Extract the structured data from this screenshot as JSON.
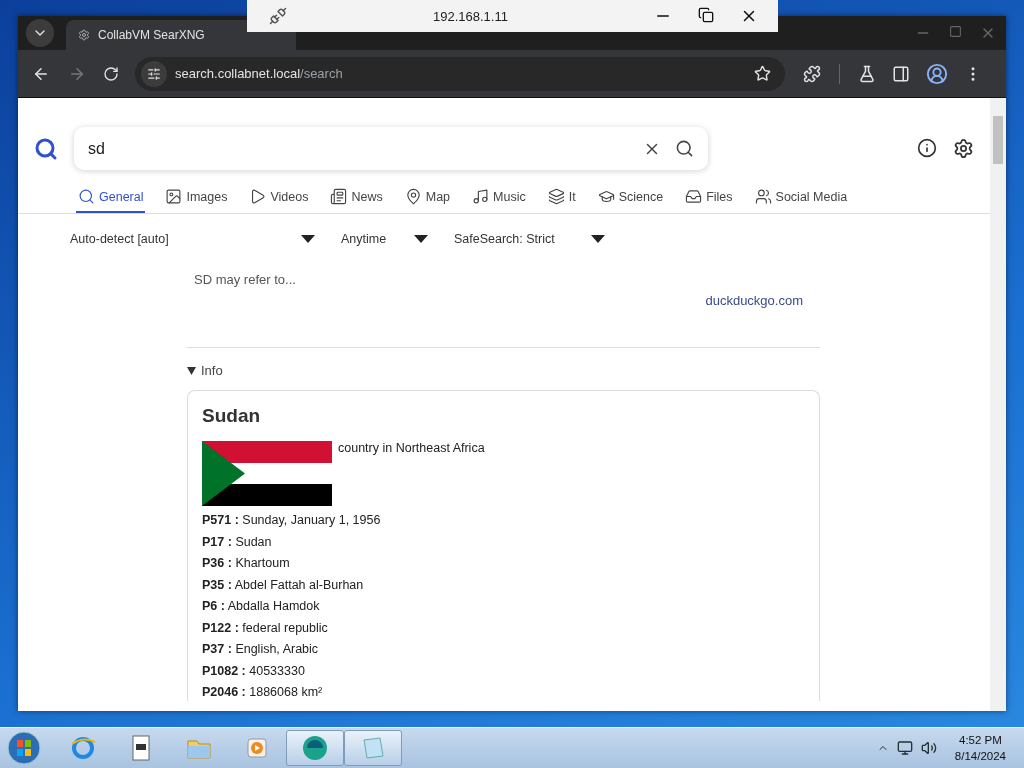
{
  "remote_bar": {
    "address": "192.168.1.11"
  },
  "browser": {
    "tab_title": "CollabVM SearXNG",
    "address": {
      "host": "search.collabnet.local",
      "path": "/search"
    }
  },
  "search": {
    "query": "sd"
  },
  "categories": [
    {
      "kind": "general",
      "label": "General",
      "selected": true
    },
    {
      "kind": "images",
      "label": "Images",
      "selected": false
    },
    {
      "kind": "videos",
      "label": "Videos",
      "selected": false
    },
    {
      "kind": "news",
      "label": "News",
      "selected": false
    },
    {
      "kind": "map",
      "label": "Map",
      "selected": false
    },
    {
      "kind": "music",
      "label": "Music",
      "selected": false
    },
    {
      "kind": "it",
      "label": "It",
      "selected": false
    },
    {
      "kind": "science",
      "label": "Science",
      "selected": false
    },
    {
      "kind": "files",
      "label": "Files",
      "selected": false
    },
    {
      "kind": "social",
      "label": "Social Media",
      "selected": false
    }
  ],
  "filters": [
    {
      "label": "Auto-detect [auto]"
    },
    {
      "label": "Anytime"
    },
    {
      "label": "SafeSearch: Strict"
    }
  ],
  "answer": {
    "text": "SD may refer to...",
    "source": "duckduckgo.com"
  },
  "infobox": {
    "toggle": "Info",
    "expanded": true,
    "title": "Sudan",
    "description": "country in Northeast Africa",
    "properties": [
      {
        "key": "P571 :",
        "value": "Sunday, January 1, 1956"
      },
      {
        "key": "P17 :",
        "value": "Sudan"
      },
      {
        "key": "P36 :",
        "value": "Khartoum"
      },
      {
        "key": "P35 :",
        "value": "Abdel Fattah al-Burhan"
      },
      {
        "key": "P6 :",
        "value": "Abdalla Hamdok"
      },
      {
        "key": "P122 :",
        "value": "federal republic"
      },
      {
        "key": "P37 :",
        "value": "English, Arabic"
      },
      {
        "key": "P1082 :",
        "value": "40533330"
      },
      {
        "key": "P2046 :",
        "value": "1886068 km²"
      }
    ]
  },
  "taskbar": {
    "apps": [
      {
        "kind": "browser",
        "running": false
      },
      {
        "kind": "document",
        "running": false
      },
      {
        "kind": "folder",
        "running": false
      },
      {
        "kind": "media",
        "running": false
      },
      {
        "kind": "globe",
        "running": true
      },
      {
        "kind": "notepad",
        "running": true
      }
    ],
    "time": "4:52 PM",
    "date": "8/14/2024"
  }
}
